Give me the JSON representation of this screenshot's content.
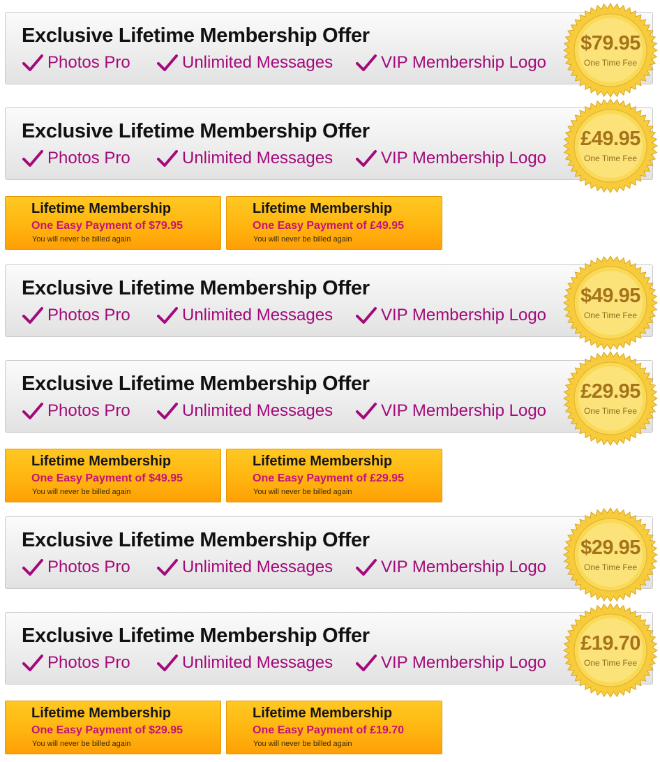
{
  "offers": [
    {
      "title": "Exclusive Lifetime Membership Offer",
      "features": [
        "Photos Pro",
        "Unlimited Messages",
        "VIP Membership Logo"
      ],
      "price": "$79.95",
      "price_note": "One Time Fee"
    },
    {
      "title": "Exclusive Lifetime Membership Offer",
      "features": [
        "Photos Pro",
        "Unlimited Messages",
        "VIP Membership Logo"
      ],
      "price": "£49.95",
      "price_note": "One Time Fee"
    },
    {
      "title": "Exclusive Lifetime Membership Offer",
      "features": [
        "Photos Pro",
        "Unlimited Messages",
        "VIP Membership Logo"
      ],
      "price": "$49.95",
      "price_note": "One Time Fee"
    },
    {
      "title": "Exclusive Lifetime Membership Offer",
      "features": [
        "Photos Pro",
        "Unlimited Messages",
        "VIP Membership Logo"
      ],
      "price": "£29.95",
      "price_note": "One Time Fee"
    },
    {
      "title": "Exclusive Lifetime Membership Offer",
      "features": [
        "Photos Pro",
        "Unlimited Messages",
        "VIP Membership Logo"
      ],
      "price": "$29.95",
      "price_note": "One Time Fee"
    },
    {
      "title": "Exclusive Lifetime Membership Offer",
      "features": [
        "Photos Pro",
        "Unlimited Messages",
        "VIP Membership Logo"
      ],
      "price": "£19.70",
      "price_note": "One Time Fee"
    }
  ],
  "payment_buttons": [
    {
      "title": "Lifetime Membership",
      "subtitle": "One Easy Payment of $79.95",
      "note": "You will never be billed again"
    },
    {
      "title": "Lifetime Membership",
      "subtitle": "One Easy Payment of £49.95",
      "note": "You will never be billed again"
    },
    {
      "title": "Lifetime Membership",
      "subtitle": "One Easy Payment of $49.95",
      "note": "You will never be billed again"
    },
    {
      "title": "Lifetime Membership",
      "subtitle": "One Easy Payment of £29.95",
      "note": "You will never be billed again"
    },
    {
      "title": "Lifetime Membership",
      "subtitle": "One Easy Payment of $29.95",
      "note": "You will never be billed again"
    },
    {
      "title": "Lifetime Membership",
      "subtitle": "One Easy Payment of £19.70",
      "note": "You will never be billed again"
    }
  ],
  "colors": {
    "feature_text": "#a3097a",
    "seal_gold": "#f3c43b",
    "button_orange": "#ffb50f",
    "button_subtitle": "#c3127a"
  },
  "icons": {
    "feature": "checkmark-icon",
    "seal": "gold-seal-badge"
  }
}
